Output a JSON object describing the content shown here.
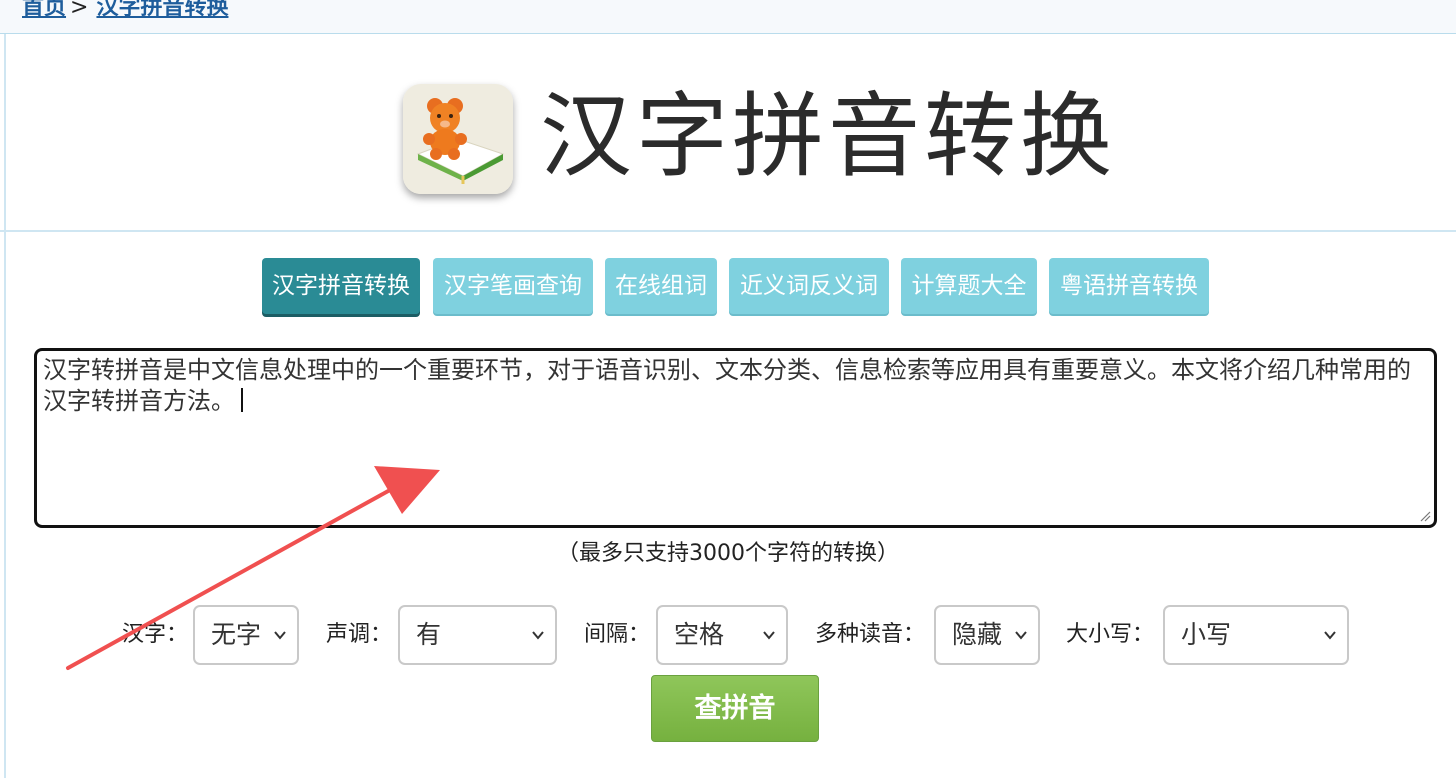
{
  "breadcrumb": {
    "home": "首页",
    "separator": ">",
    "current": "汉字拼音转换"
  },
  "header": {
    "title": "汉字拼音转换",
    "logo_icon": "teddy-bear-book-icon"
  },
  "tabs": [
    {
      "label": "汉字拼音转换",
      "active": true
    },
    {
      "label": "汉字笔画查询",
      "active": false
    },
    {
      "label": "在线组词",
      "active": false
    },
    {
      "label": "近义词反义词",
      "active": false
    },
    {
      "label": "计算题大全",
      "active": false
    },
    {
      "label": "粤语拼音转换",
      "active": false
    }
  ],
  "input": {
    "value": "汉字转拼音是中文信息处理中的一个重要环节，对于语音识别、文本分类、信息检索等应用具有重要意义。本文将介绍几种常用的汉字转拼音方法。"
  },
  "hint": "（最多只支持3000个字符的转换）",
  "options": {
    "hanzi": {
      "label": "汉字：",
      "selected": "无字"
    },
    "tone": {
      "label": "声调：",
      "selected": "有"
    },
    "separator": {
      "label": "间隔：",
      "selected": "空格"
    },
    "polyphone": {
      "label": "多种读音：",
      "selected": "隐藏"
    },
    "case": {
      "label": "大小写：",
      "selected": "小写"
    }
  },
  "submit_label": "查拼音",
  "colors": {
    "tab_active": "#2a8b95",
    "tab_inactive": "#7fd1df",
    "link": "#1e5d9c",
    "submit_green": "#7fb84a",
    "annotation_arrow": "#f05050"
  }
}
